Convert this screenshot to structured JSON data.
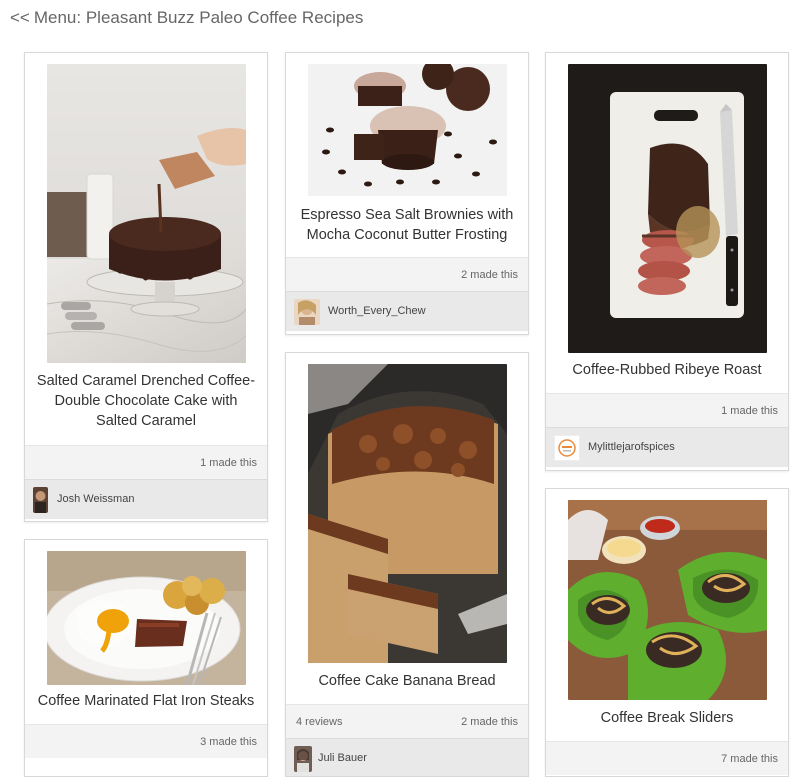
{
  "header": {
    "back_chevron": "<<",
    "title": "Menu: Pleasant Buzz Paleo Coffee Recipes"
  },
  "cards": [
    {
      "title": "Salted Caramel Drenched Coffee-Double Chocolate Cake with Salted Caramel",
      "made": "1 made this",
      "author": "Josh Weissman",
      "image": "chocolate-cake-photo"
    },
    {
      "title": "Coffee Marinated Flat Iron Steaks",
      "made": "3 made this",
      "image": "steak-egg-photo"
    },
    {
      "title": "Espresso Sea Salt Brownies with Mocha Coconut Butter Frosting",
      "made": "2 made this",
      "author": "Worth_Every_Chew",
      "image": "brownies-photo"
    },
    {
      "title": "Coffee Cake Banana Bread",
      "reviews": "4 reviews",
      "made": "2 made this",
      "author": "Juli Bauer",
      "image": "banana-bread-photo"
    },
    {
      "title": "Coffee-Rubbed Ribeye Roast",
      "made": "1 made this",
      "author": "Mylittlejarofspices",
      "image": "ribeye-roast-photo"
    },
    {
      "title": "Coffee Break Sliders",
      "made": "7 made this",
      "image": "sliders-photo"
    }
  ]
}
